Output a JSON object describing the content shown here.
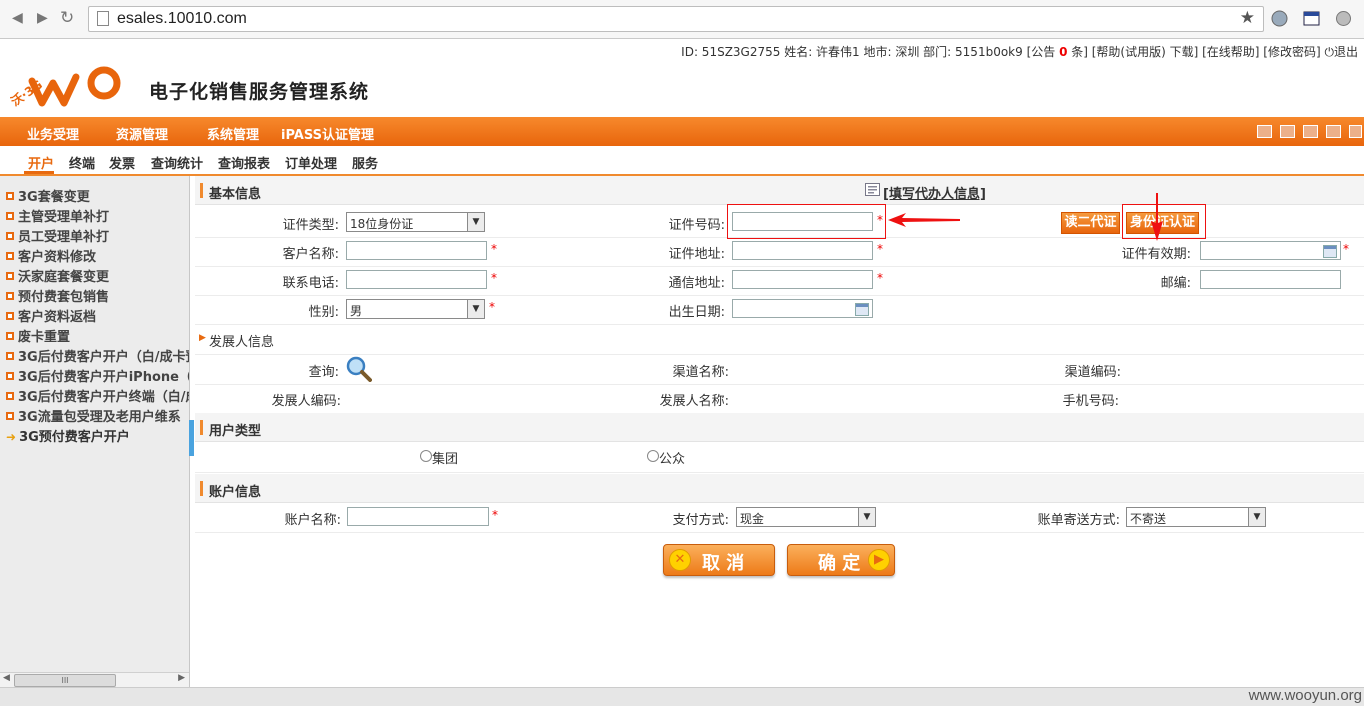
{
  "browser": {
    "url": "esales.10010.com"
  },
  "header": {
    "userinfo_prefix": "ID: 51SZ3G2755 姓名: 许春伟1 地市: 深圳 部门: 5151b0ok9 [公告 ",
    "notice_count": "0",
    "userinfo_suffix": " 条] [帮助(试用版) 下载] [在线帮助] [修改密码]",
    "logout": "退出",
    "logo_text": "沃·3G",
    "system_title": "电子化销售服务管理系统"
  },
  "main_menu": [
    "业务受理",
    "资源管理",
    "系统管理",
    "iPASS认证管理"
  ],
  "sub_menu": [
    "开户",
    "终端",
    "发票",
    "查询统计",
    "查询报表",
    "订单处理",
    "服务"
  ],
  "sidebar": {
    "items": [
      "3G套餐变更",
      "主管受理单补打",
      "员工受理单补打",
      "客户资料修改",
      "沃家庭套餐变更",
      "预付费套包销售",
      "客户资料返档",
      "废卡重置",
      "3G后付费客户开户（白/成卡預",
      "3G后付费客户开户iPhone（白",
      "3G后付费客户开户终端（白/成",
      "3G流量包受理及老用户维系",
      "3G预付费客户开户"
    ],
    "scroll_thumb": "III"
  },
  "basic": {
    "title": "基本信息",
    "agent_link": "[填写代办人信息]",
    "cert_type_label": "证件类型:",
    "cert_type_value": "18位身份证",
    "cert_no_label": "证件号码:",
    "btn_read": "读二代证",
    "btn_verify": "身份证认证",
    "cust_name_label": "客户名称:",
    "cert_addr_label": "证件地址:",
    "cert_valid_label": "证件有效期:",
    "phone_label": "联系电话:",
    "mail_addr_label": "通信地址:",
    "zip_label": "邮编:",
    "gender_label": "性别:",
    "gender_value": "男",
    "birth_label": "出生日期:",
    "required": "*"
  },
  "developer": {
    "title": "发展人信息",
    "query_label": "查询:",
    "channel_name_label": "渠道名称:",
    "channel_code_label": "渠道编码:",
    "dev_code_label": "发展人编码:",
    "dev_name_label": "发展人名称:",
    "mobile_label": "手机号码:"
  },
  "user_type": {
    "title": "用户类型",
    "opt_group": "集团",
    "opt_public": "公众"
  },
  "account": {
    "title": "账户信息",
    "name_label": "账户名称:",
    "pay_label": "支付方式:",
    "pay_value": "现金",
    "bill_label": "账单寄送方式:",
    "bill_value": "不寄送"
  },
  "actions": {
    "cancel": "取 消",
    "confirm": "确 定"
  },
  "watermark": "www.wooyun.org",
  "colors": {
    "brand_orange": "#e8650c",
    "annotation_red": "#e11111"
  }
}
